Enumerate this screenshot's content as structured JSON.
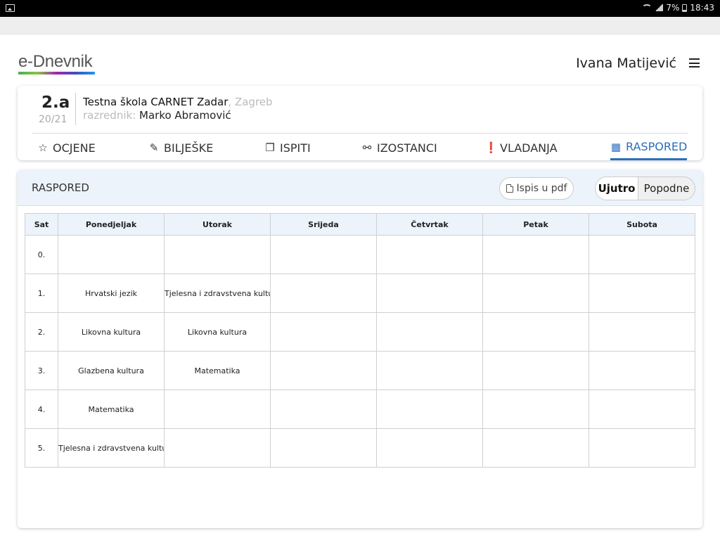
{
  "status_bar": {
    "battery": "7%",
    "time": "18:43"
  },
  "header": {
    "logo": "e-Dnevnik",
    "user_name": "Ivana Matijević"
  },
  "class_info": {
    "name": "2.a",
    "year": "20/21",
    "school": "Testna škola CARNET Zadar",
    "city": ", Zagreb",
    "teacher_label": "razrednik:",
    "teacher_name": "Marko Abramović"
  },
  "nav": {
    "tabs": [
      {
        "label": "OCJENE",
        "icon": "star-icon"
      },
      {
        "label": "BILJEŠKE",
        "icon": "edit-icon"
      },
      {
        "label": "ISPITI",
        "icon": "copy-icon"
      },
      {
        "label": "IZOSTANCI",
        "icon": "broken-link-icon"
      },
      {
        "label": "VLADANJA",
        "icon": "exclamation-circle-icon"
      },
      {
        "label": "RASPORED",
        "icon": "calendar-icon",
        "active": true
      }
    ]
  },
  "schedule": {
    "title": "RASPORED",
    "pdf_button": "Ispis u pdf",
    "shift_options": [
      "Ujutro",
      "Popodne"
    ],
    "selected_shift": "Ujutro",
    "columns": [
      "Sat",
      "Ponedjeljak",
      "Utorak",
      "Srijeda",
      "Četvrtak",
      "Petak",
      "Subota"
    ],
    "rows": [
      [
        "0.",
        "",
        "",
        "",
        "",
        "",
        ""
      ],
      [
        "1.",
        "Hrvatski jezik",
        "Tjelesna i zdravstvena kultura",
        "",
        "",
        "",
        ""
      ],
      [
        "2.",
        "Likovna kultura",
        "Likovna kultura",
        "",
        "",
        "",
        ""
      ],
      [
        "3.",
        "Glazbena kultura",
        "Matematika",
        "",
        "",
        "",
        ""
      ],
      [
        "4.",
        "Matematika",
        "",
        "",
        "",
        "",
        ""
      ],
      [
        "5.",
        "Tjelesna i zdravstvena kultura",
        "",
        "",
        "",
        "",
        ""
      ]
    ]
  },
  "colors": {
    "accent": "#2a6ebd",
    "header_bg": "#ecf3fb"
  }
}
